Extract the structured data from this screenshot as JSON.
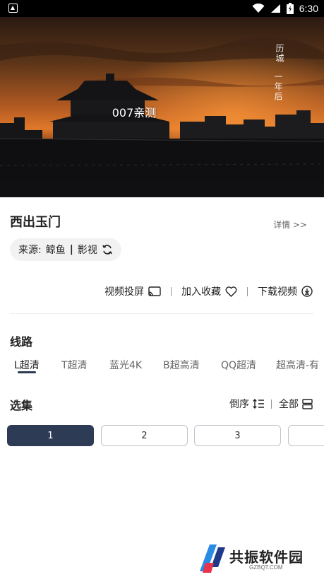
{
  "status_bar": {
    "time": "6:30",
    "icons": [
      "notification-icon",
      "wifi-icon",
      "signal-icon",
      "battery-icon"
    ]
  },
  "player": {
    "title": "007亲测",
    "vertical_text_1": "历城",
    "vertical_text_2": "一年后"
  },
  "movie": {
    "title": "西出玉门",
    "detail_link": "详情 >>",
    "source_label": "来源:",
    "source_name": "鲸鱼",
    "source_separator": "|",
    "source_category": "影视"
  },
  "actions": {
    "cast": "视频投屏",
    "favorite": "加入收藏",
    "download": "下载视频"
  },
  "routes": {
    "label": "线路",
    "items": [
      "L超清",
      "T超清",
      "蓝光4K",
      "B超高清",
      "QQ超清",
      "超高清-有"
    ],
    "active_index": 0
  },
  "episodes": {
    "label": "选集",
    "sort": "倒序",
    "all": "全部",
    "items": [
      "1",
      "2",
      "3",
      ""
    ],
    "active_index": 0
  },
  "watermark": {
    "text": "共振软件园",
    "sub": "GZBQT.COM"
  },
  "colors": {
    "accent": "#2e3b55",
    "pill_bg": "#f2f2f3",
    "sky_top": "#2b1a12",
    "sky_glow": "#e0782a"
  }
}
